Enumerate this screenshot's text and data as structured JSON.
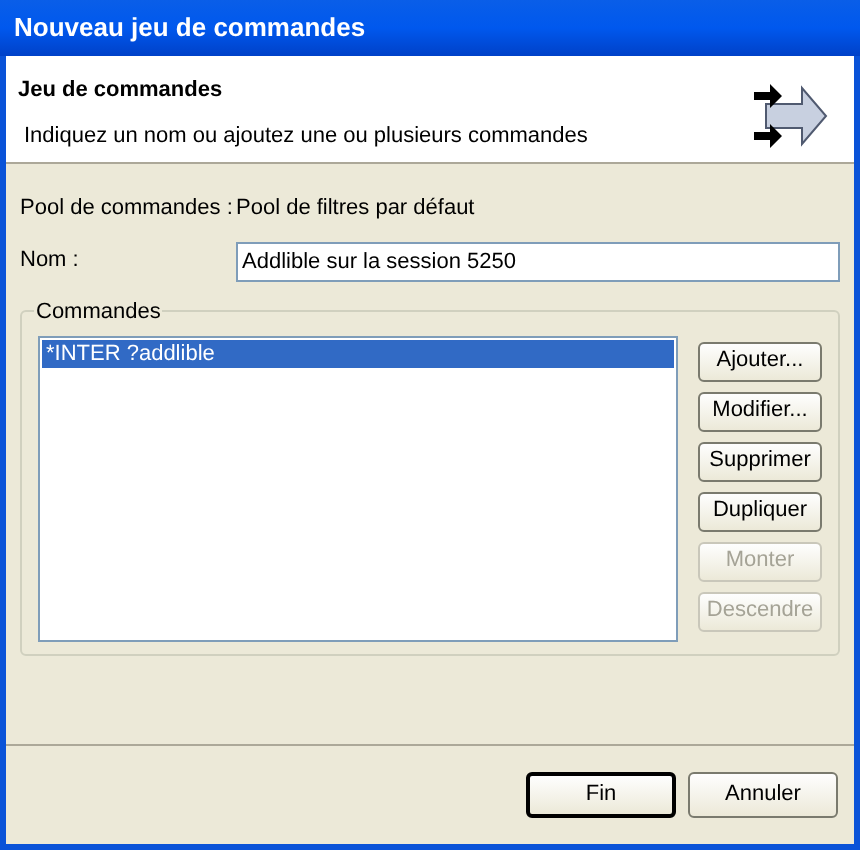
{
  "window": {
    "title": "Nouveau jeu de commandes"
  },
  "header": {
    "title": "Jeu de commandes",
    "description": "Indiquez un nom ou ajoutez une ou plusieurs commandes"
  },
  "pool": {
    "label": "Pool de commandes :",
    "value": "Pool de filtres par défaut"
  },
  "name": {
    "label": "Nom :",
    "value": "Addlible sur la session 5250"
  },
  "commands": {
    "title": "Commandes",
    "items": [
      {
        "text": "*INTER ?addlible",
        "selected": true
      }
    ],
    "buttons": [
      {
        "label": "Ajouter...",
        "disabled": false
      },
      {
        "label": "Modifier...",
        "disabled": false
      },
      {
        "label": "Supprimer",
        "disabled": false
      },
      {
        "label": "Dupliquer",
        "disabled": false
      },
      {
        "label": "Monter",
        "disabled": true
      },
      {
        "label": "Descendre",
        "disabled": true
      }
    ]
  },
  "footer_buttons": [
    {
      "label": "Fin",
      "default": true
    },
    {
      "label": "Annuler",
      "default": false
    }
  ]
}
